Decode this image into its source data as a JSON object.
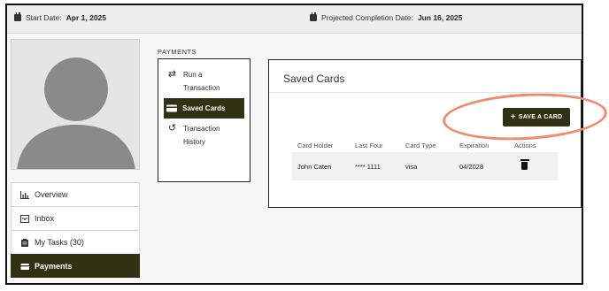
{
  "topbar": {
    "start_label": "Start Date:",
    "start_value": "Apr 1, 2025",
    "completion_label": "Projected Completion Date:",
    "completion_value": "Jun 16, 2025"
  },
  "sidebar": {
    "items": [
      {
        "label": "Overview",
        "icon": "chart-icon"
      },
      {
        "label": "Inbox",
        "icon": "inbox-icon"
      },
      {
        "label": "My Tasks (30)",
        "icon": "clipboard-icon"
      },
      {
        "label": "Payments",
        "icon": "credit-card-icon",
        "active": true
      }
    ]
  },
  "payments": {
    "section_label": "PAYMENTS",
    "menu": [
      {
        "label": "Run a Transaction",
        "icon": "swap-arrows-icon"
      },
      {
        "label": "Saved Cards",
        "icon": "credit-card-icon",
        "active": true
      },
      {
        "label": "Transaction History",
        "icon": "history-icon"
      }
    ]
  },
  "saved_cards": {
    "title": "Saved Cards",
    "save_button_label": "SAVE A CARD",
    "columns": [
      "Card Holder",
      "Last Four",
      "Card Type",
      "Expiration",
      "Actions"
    ],
    "rows": [
      {
        "holder": "John Caten",
        "last_four": "**** 1111",
        "type": "visa",
        "expiration": "04/2028"
      }
    ]
  },
  "colors": {
    "accent": "#2f3213",
    "highlight": "#ee8a6f"
  }
}
